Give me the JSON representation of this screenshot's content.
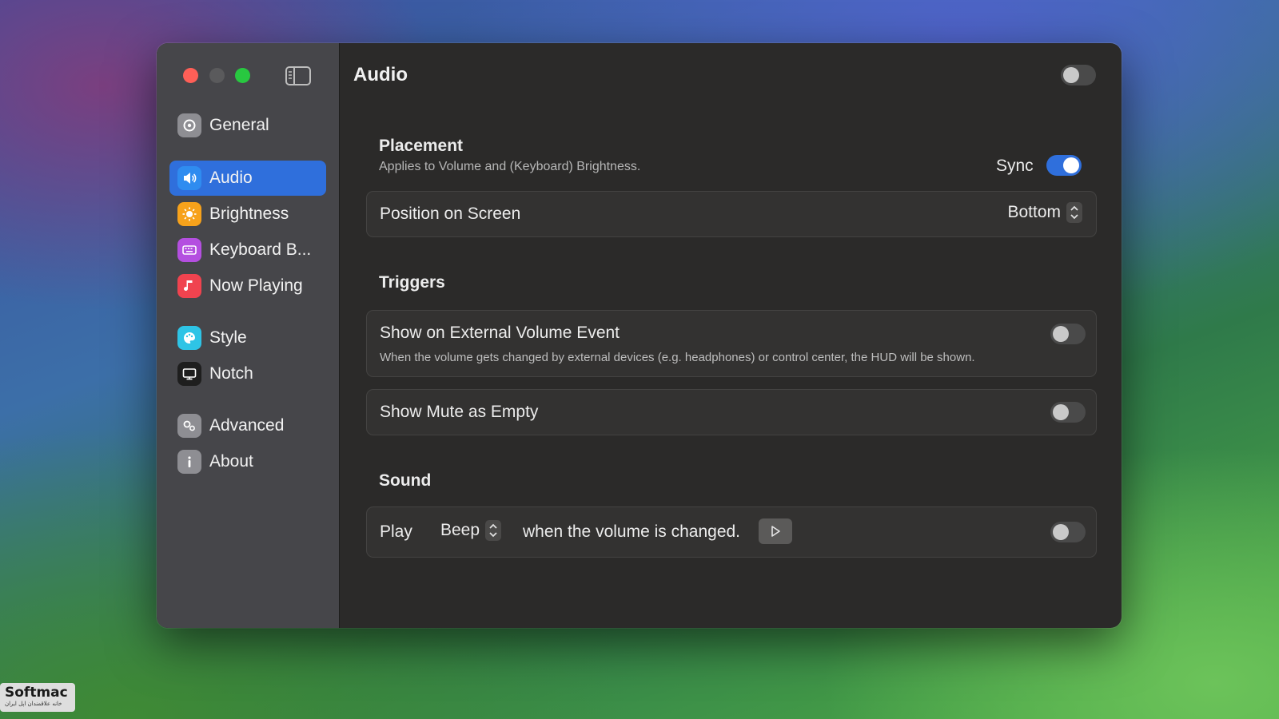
{
  "window": {
    "title": "Audio"
  },
  "sidebar": {
    "items": [
      {
        "label": "General",
        "icon": "gear-icon",
        "color": "#8e8e93",
        "active": false
      },
      {
        "label": "Audio",
        "icon": "speaker-icon",
        "color": "#2f8cf0",
        "active": true
      },
      {
        "label": "Brightness",
        "icon": "sun-icon",
        "color": "#f7a21b",
        "active": false
      },
      {
        "label": "Keyboard B...",
        "icon": "keyboard-icon",
        "color": "#b44fe0",
        "active": false
      },
      {
        "label": "Now Playing",
        "icon": "music-note-icon",
        "color": "#f0434f",
        "active": false
      },
      {
        "label": "Style",
        "icon": "palette-icon",
        "color": "#2ec4e6",
        "active": false
      },
      {
        "label": "Notch",
        "icon": "display-icon",
        "color": "#1e1e1e",
        "active": false
      },
      {
        "label": "Advanced",
        "icon": "gears-icon",
        "color": "#8e8e93",
        "active": false
      },
      {
        "label": "About",
        "icon": "info-icon",
        "color": "#8e8e93",
        "active": false
      }
    ]
  },
  "header": {
    "title": "Audio",
    "enabled": false
  },
  "placement": {
    "title": "Placement",
    "subtitle": "Applies to Volume and (Keyboard) Brightness.",
    "sync_label": "Sync",
    "sync_on": true,
    "position_label": "Position on Screen",
    "position_value": "Bottom"
  },
  "triggers": {
    "title": "Triggers",
    "external_label": "Show on External Volume Event",
    "external_desc": "When the volume gets changed by external devices (e.g. headphones) or control center, the HUD will be shown.",
    "external_on": false,
    "mute_label": "Show Mute as Empty",
    "mute_on": false
  },
  "sound": {
    "title": "Sound",
    "play_label": "Play",
    "sound_value": "Beep",
    "suffix": "when the volume is changed.",
    "enabled": false
  },
  "watermark": {
    "brand": "Softmac",
    "tagline": "خانه علاقمندان اپل ایران"
  },
  "colors": {
    "accent": "#2f6fdc",
    "close": "#ff5f57",
    "maximize": "#28c840"
  }
}
